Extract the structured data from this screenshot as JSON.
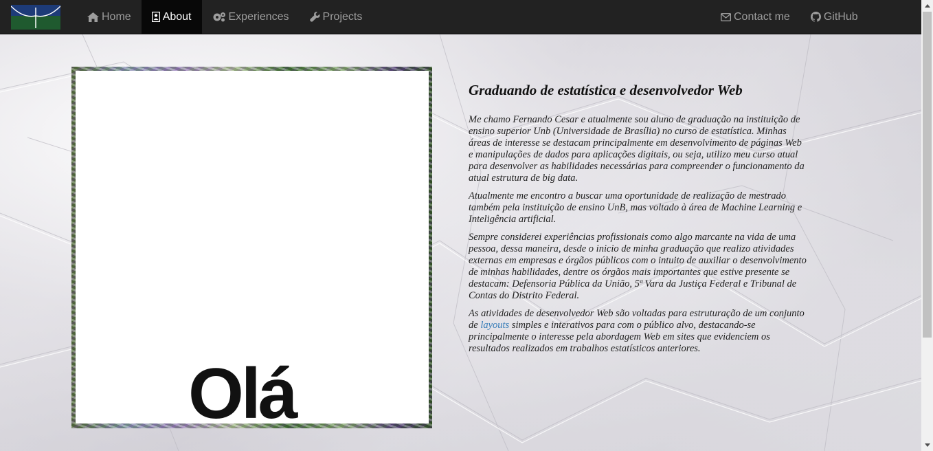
{
  "navbar": {
    "brand_logo": "unb-logo",
    "items_left": [
      {
        "label": "Home",
        "icon": "home-icon"
      },
      {
        "label": "About",
        "icon": "id-card-icon",
        "active": true
      },
      {
        "label": "Experiences",
        "icon": "gears-icon"
      },
      {
        "label": "Projects",
        "icon": "wrench-icon"
      }
    ],
    "items_right": [
      {
        "label": "Contact me",
        "icon": "envelope-icon"
      },
      {
        "label": "GitHub",
        "icon": "github-icon"
      }
    ]
  },
  "photo": {
    "caption": "Olá"
  },
  "about": {
    "title": "Graduando de estatística e desenvolvedor Web",
    "p1": "Me chamo Fernando Cesar e atualmente sou aluno de graduação na instituição de ensino superior Unb (Universidade de Brasília) no curso de estatística. Minhas áreas de interesse se destacam principalmente em desenvolvimento de páginas Web e manipulações de dados para aplicações digitais, ou seja, utilizo meu curso atual para desenvolver as habilidades necessárias para compreender o funcionamento da atual estrutura de big data.",
    "p2": "Atualmente me encontro a buscar uma oportunidade de realização de mestrado também pela instituição de ensino UnB, mas voltado à área de Machine Learning e Inteligência artificial.",
    "p3": "Sempre considerei experiências profissionais como algo marcante na vida de uma pessoa, dessa maneira, desde o inicio de minha graduação que realizo atividades externas em empresas e órgãos públicos com o intuito de auxiliar o desenvolvimento de minhas habilidades, dentre os órgãos mais importantes que estive presente se destacam: Defensoria Pública da União, 5ª Vara da Justiça Federal e Tribunal de Contas do Distrito Federal.",
    "p4_before": "As atividades de desenvolvedor Web são voltadas para estruturação de um conjunto de ",
    "p4_link": "layouts",
    "p4_after": " simples e interativos para com o público alvo, destacando-se principalmente o interesse pela abordagem Web em sites que evidenciem os resultados realizados em trabalhos estatísticos anteriores."
  },
  "colors": {
    "navbar_bg": "#222222",
    "nav_text": "#9d9d9d",
    "nav_active_bg": "#080808",
    "link": "#337ab7"
  }
}
